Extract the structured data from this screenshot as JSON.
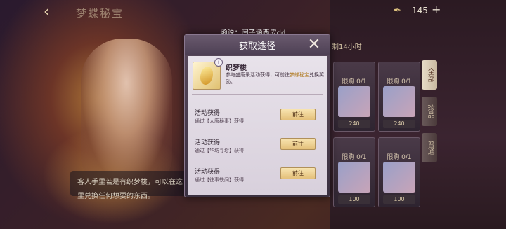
{
  "header": {
    "title": "梦蝶秘宝",
    "currency_amount": "145"
  },
  "notice": "函说：闫子涵西皮dd",
  "timer": "剩14小时",
  "hint": "客人手里若是有织梦梭，可以在这里兑换任何想要的东西。",
  "side_tabs": [
    "全部",
    "珍品",
    "普通"
  ],
  "cards": [
    {
      "label": "限购 0/1",
      "price": "240"
    },
    {
      "label": "限购 0/1",
      "price": "240"
    },
    {
      "label": "限购 0/1",
      "price": "100"
    },
    {
      "label": "限购 0/1",
      "price": "100"
    }
  ],
  "modal": {
    "title": "获取途径",
    "item": {
      "name": "织梦梭",
      "desc_prefix": "参与盛唐录活动获得，可前往",
      "desc_highlight": "梦蝶秘宝",
      "desc_suffix": "兑换奖励。"
    },
    "sources": [
      {
        "title": "活动获得",
        "sub": "通过【大唐秘事】获得",
        "button": "前往"
      },
      {
        "title": "活动获得",
        "sub": "通过【华坊寻珍】获得",
        "button": "前往"
      },
      {
        "title": "活动获得",
        "sub": "通过【往事轶闻】获得",
        "button": "前往"
      }
    ]
  }
}
